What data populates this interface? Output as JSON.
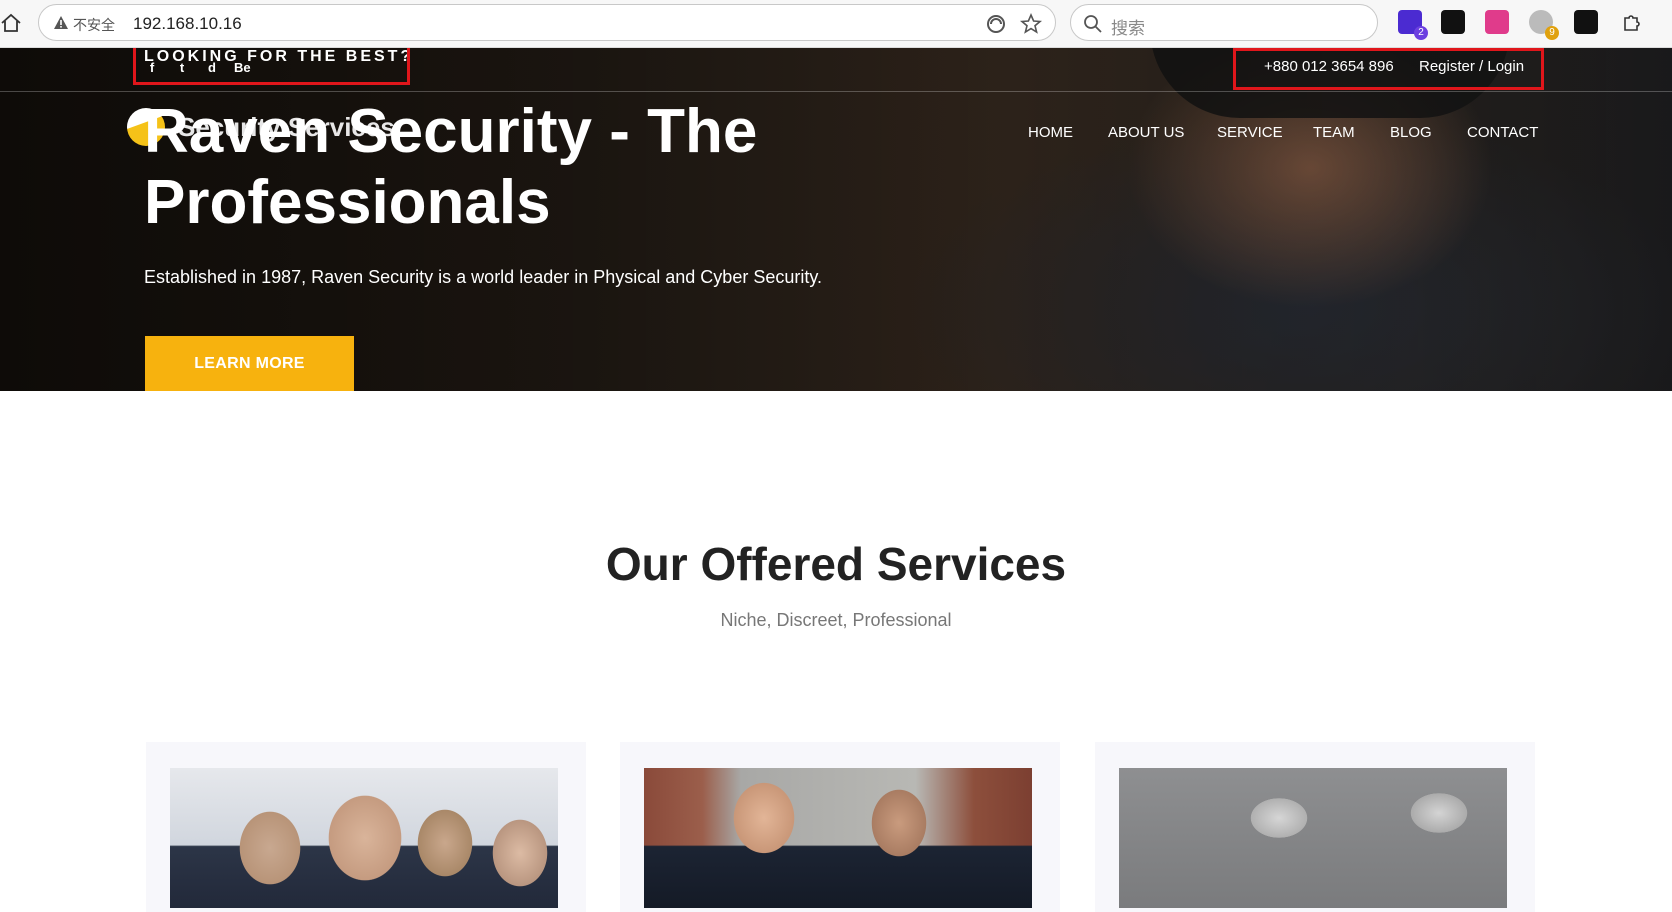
{
  "browser": {
    "insecure_label": "不安全",
    "url": "192.168.10.16",
    "search_placeholder": "搜索",
    "extensions": [
      {
        "name": "ext-1",
        "badge": "2"
      },
      {
        "name": "ext-2",
        "badge": ""
      },
      {
        "name": "ext-3",
        "badge": ""
      },
      {
        "name": "ext-4",
        "badge": "9"
      },
      {
        "name": "ext-5",
        "badge": ""
      }
    ]
  },
  "topbar": {
    "tagline": "LOOKING FOR THE BEST?",
    "socials": [
      "f",
      "t",
      "d",
      "Be"
    ],
    "phone": "+880 012 3654 896",
    "auth": "Register / Login"
  },
  "logo": {
    "text": "Security Services"
  },
  "nav": [
    "HOME",
    "ABOUT US",
    "SERVICE",
    "TEAM",
    "BLOG",
    "CONTACT"
  ],
  "hero": {
    "title": "Raven Security - The Professionals",
    "subtitle": "Established in 1987, Raven Security is a world leader in Physical and Cyber Security.",
    "cta": "LEARN MORE"
  },
  "services": {
    "title": "Our Offered Services",
    "subtitle": "Niche, Discreet, Professional"
  },
  "colors": {
    "accent": "#f7b20e",
    "highlight": "#e0161b",
    "heading": "#222222"
  }
}
